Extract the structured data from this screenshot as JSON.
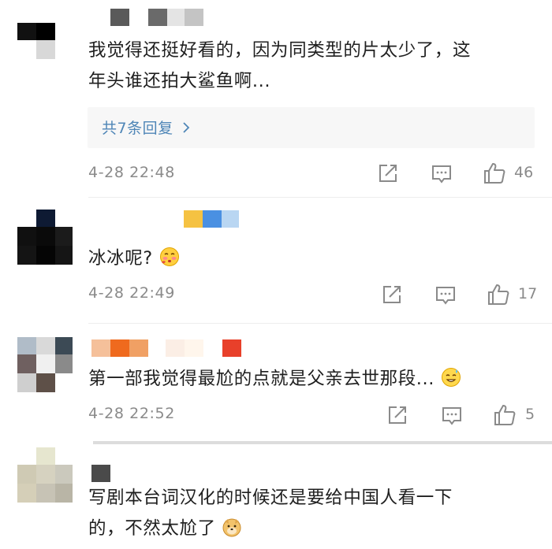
{
  "comments": [
    {
      "text_lines": [
        "我觉得还挺好看的，因为同类型的片太少了，这",
        "年头谁还拍大鲨鱼啊..."
      ],
      "replies_label": "共7条回复",
      "timestamp": "4-28 22:48",
      "likes": "46"
    },
    {
      "text_lines": [
        "冰冰呢?"
      ],
      "emoji": "blushing-emoji",
      "timestamp": "4-28 22:49",
      "likes": "17"
    },
    {
      "text_lines": [
        "第一部我觉得最尬的点就是父亲去世那段..."
      ],
      "emoji": "sweating-smile-emoji",
      "timestamp": "4-28 22:52",
      "likes": "5"
    },
    {
      "text_lines": [
        "写剧本台词汉化的时候还是要给中国人看一下",
        "的，不然太尬了"
      ],
      "emoji": "doge-emoji"
    }
  ],
  "icons": {
    "share": "share-icon",
    "comment": "comment-icon",
    "like": "thumbs-up-icon",
    "chevron": "chevron-right-icon"
  },
  "colors": {
    "link": "#4f86b7",
    "meta": "#8a8a8a",
    "reply_bg": "#f7f7f7"
  }
}
